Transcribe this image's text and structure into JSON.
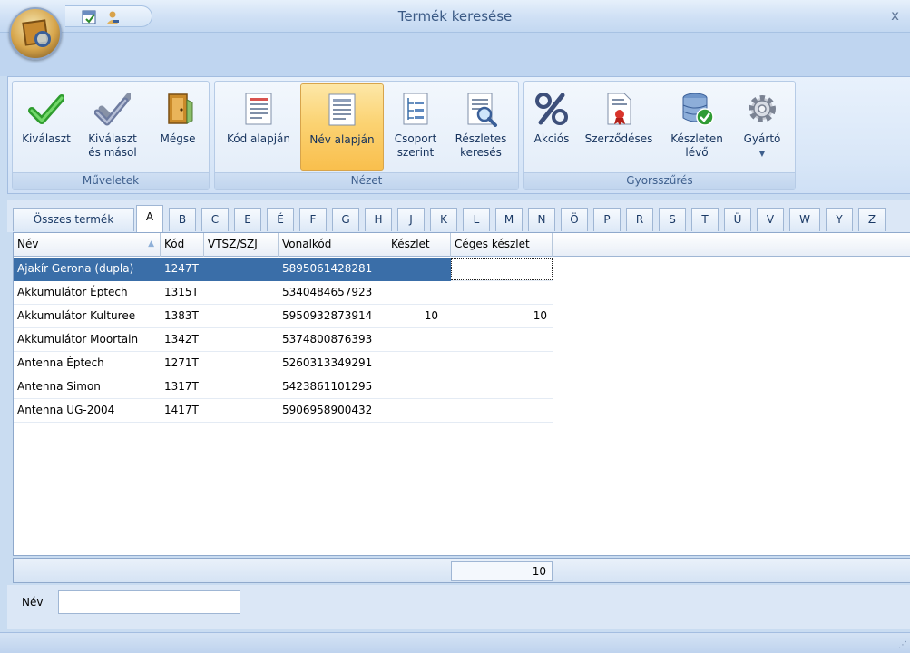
{
  "window": {
    "title": "Termék keresése",
    "close_glyph": "x"
  },
  "ribbon": {
    "groups": [
      {
        "label": "Műveletek",
        "buttons": [
          {
            "label": "Kiválaszt",
            "icon": "checkmark-green-icon"
          },
          {
            "label": "Kiválaszt és másol",
            "icon": "checkmark-copy-icon"
          },
          {
            "label": "Mégse",
            "icon": "exit-door-icon"
          }
        ]
      },
      {
        "label": "Nézet",
        "buttons": [
          {
            "label": "Kód alapján",
            "icon": "list-view-icon"
          },
          {
            "label": "Név alapján",
            "icon": "list-view-icon",
            "active": true
          },
          {
            "label": "Csoport szerint",
            "icon": "tree-view-icon"
          },
          {
            "label": "Részletes keresés",
            "icon": "search-document-icon"
          }
        ]
      },
      {
        "label": "Gyorsszűrés",
        "buttons": [
          {
            "label": "Akciós",
            "icon": "percent-icon"
          },
          {
            "label": "Szerződéses",
            "icon": "contract-ribbon-icon"
          },
          {
            "label": "Készleten lévő",
            "icon": "stock-database-icon"
          },
          {
            "label": "Gyártó",
            "icon": "gear-icon"
          }
        ]
      }
    ]
  },
  "letter_tabs": [
    "Összes termék",
    "A",
    "B",
    "C",
    "E",
    "É",
    "F",
    "G",
    "H",
    "J",
    "K",
    "L",
    "M",
    "N",
    "Ö",
    "P",
    "R",
    "S",
    "T",
    "Ü",
    "V",
    "W",
    "Y",
    "Z"
  ],
  "selected_tab": "A",
  "grid": {
    "columns": [
      "Név",
      "Kód",
      "VTSZ/SZJ",
      "Vonalkód",
      "Készlet",
      "Céges készlet"
    ],
    "rows": [
      [
        "Ajakír Gerona (dupla)",
        "1247T",
        "",
        "5895061428281",
        "",
        ""
      ],
      [
        "Akkumulátor Éptech",
        "1315T",
        "",
        "5340484657923",
        "",
        ""
      ],
      [
        "Akkumulátor Kulturee",
        "1383T",
        "",
        "5950932873914",
        "10",
        "10"
      ],
      [
        "Akkumulátor Moortain",
        "1342T",
        "",
        "5374800876393",
        "",
        ""
      ],
      [
        "Antenna Éptech",
        "1271T",
        "",
        "5260313349291",
        "",
        ""
      ],
      [
        "Antenna Simon",
        "1317T",
        "",
        "5423861101295",
        "",
        ""
      ],
      [
        "Antenna UG-2004",
        "1417T",
        "",
        "5906958900432",
        "",
        ""
      ]
    ],
    "summary_total": "10"
  },
  "filter": {
    "label": "Név",
    "value": ""
  },
  "colors": {
    "accent": "#3a6ea8",
    "ribbon_active": "#fbd373",
    "frame": "#c9dcf1"
  }
}
